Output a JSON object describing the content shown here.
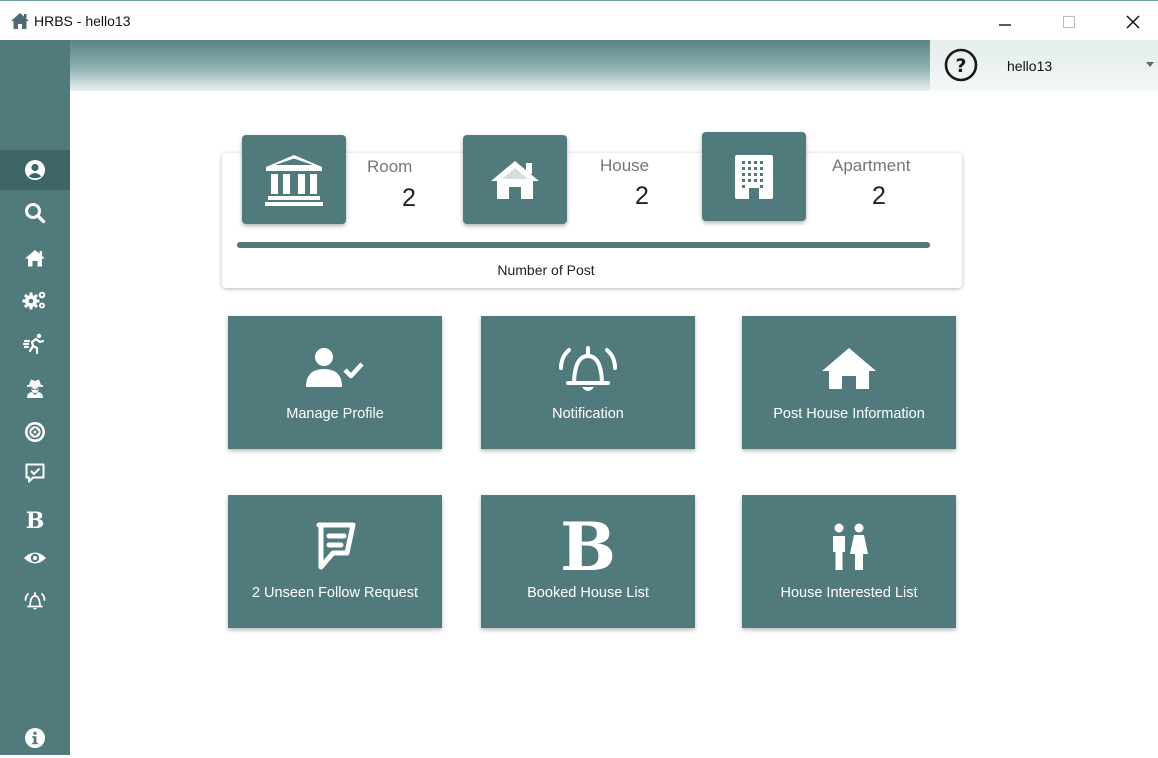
{
  "window": {
    "title": "HRBS - hello13",
    "app_icon": "home-icon",
    "controls": {
      "minimize": "minimize-icon",
      "maximize": "maximize-icon",
      "close": "close-icon"
    }
  },
  "header": {
    "help_icon": "question-circle-icon",
    "username": "hello13"
  },
  "sidebar": {
    "items": [
      {
        "icon": "user-circle-icon",
        "active": true
      },
      {
        "icon": "search-icon"
      },
      {
        "icon": "home-icon"
      },
      {
        "icon": "cogs-icon"
      },
      {
        "icon": "running-icon"
      },
      {
        "icon": "user-secret-icon"
      },
      {
        "icon": "bullseye-link-icon"
      },
      {
        "icon": "comment-check-icon"
      },
      {
        "icon": "bold-b-icon",
        "glyph": "B"
      },
      {
        "icon": "eye-icon"
      },
      {
        "icon": "bell-ringing-icon"
      }
    ],
    "footer_icon": "info-circle-icon"
  },
  "stats": {
    "items": [
      {
        "label": "Room",
        "value": "2",
        "icon": "bank-icon"
      },
      {
        "label": "House",
        "value": "2",
        "icon": "home-icon"
      },
      {
        "label": "Apartment",
        "value": "2",
        "icon": "building-icon"
      }
    ],
    "progress_fraction": 1.0,
    "caption": "Number of Post"
  },
  "tiles": [
    {
      "label": "Manage Profile",
      "icon": "user-check-icon"
    },
    {
      "label": "Notification",
      "icon": "bell-ringing-icon"
    },
    {
      "label": "Post House Information",
      "icon": "home-icon"
    },
    {
      "label": "2 Unseen Follow Request",
      "icon": "foursquare-icon"
    },
    {
      "label": "Booked House List",
      "icon": "bold-b-icon",
      "glyph": "B"
    },
    {
      "label": "House Interested List",
      "icon": "male-female-icon"
    }
  ],
  "colors": {
    "primary": "#517a7d",
    "sidebar_active": "#3f6467",
    "tile_text": "#ffffff"
  }
}
